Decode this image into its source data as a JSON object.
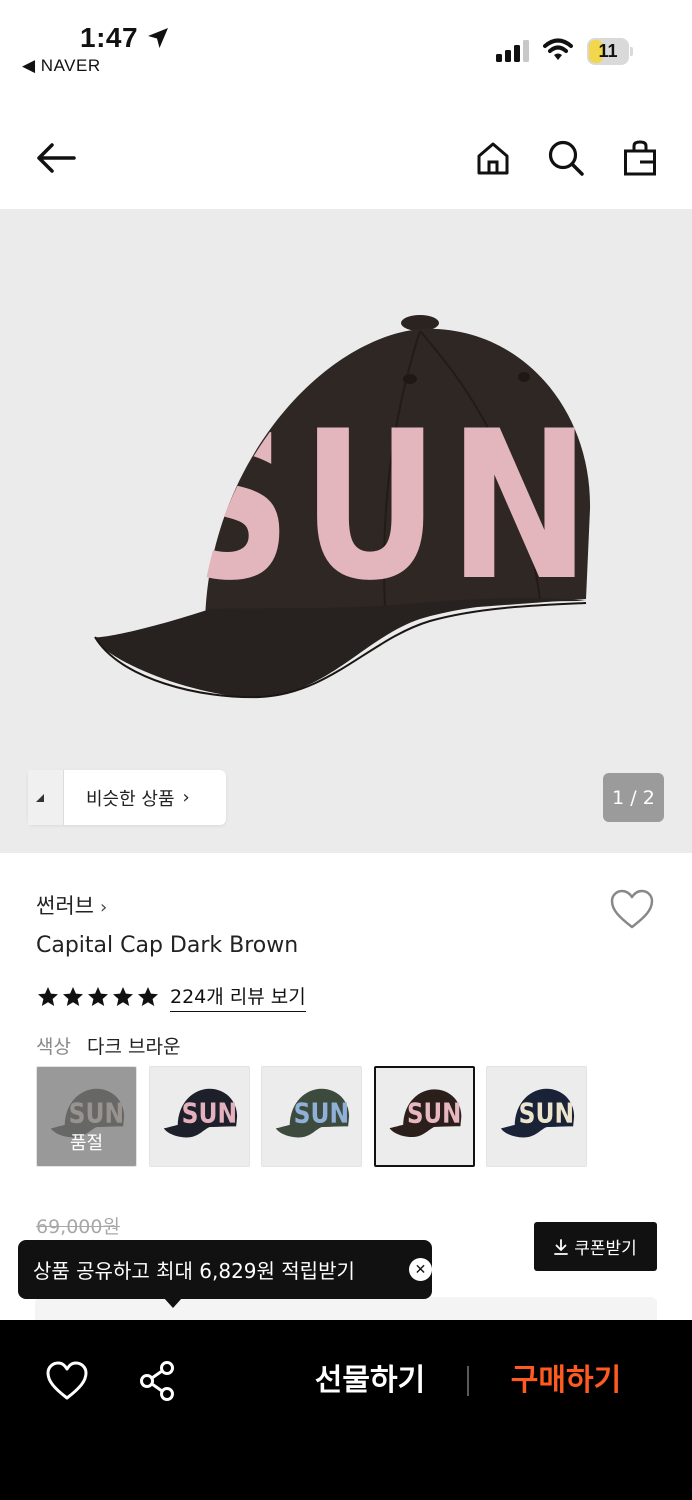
{
  "status_bar": {
    "time": "1:47",
    "back_app": "◀ NAVER",
    "battery": "11"
  },
  "icons": {
    "back": "arrow-left-icon",
    "home": "home-icon",
    "search": "search-icon",
    "bag": "shopping-bag-icon",
    "wish": "heart-icon",
    "share": "share-icon",
    "download": "download-icon",
    "close": "close-circle-icon"
  },
  "gallery": {
    "similar_label": "비슷한 상품",
    "counter": "1 / 2",
    "cap_text": "SUN"
  },
  "product": {
    "brand": "썬러브",
    "brand_chevron": "›",
    "title": "Capital Cap Dark Brown",
    "rating": 5,
    "review_link": "224개 리뷰 보기",
    "color_label": "색상",
    "color_value": "다크 브라운",
    "swatches": [
      {
        "color": "#3a3a32",
        "text_color": "#e8d8c8",
        "soldout": true,
        "soldout_label": "품절"
      },
      {
        "color": "#1d1f2a",
        "text_color": "#e4b0bc",
        "soldout": false
      },
      {
        "color": "#3d4a3e",
        "text_color": "#8fb0d8",
        "soldout": false
      },
      {
        "color": "#2b1f1c",
        "text_color": "#e8b8c0",
        "soldout": false,
        "selected": true
      },
      {
        "color": "#1a2238",
        "text_color": "#ece4cc",
        "soldout": false
      }
    ],
    "original_price": "69,000원",
    "coupon_label": "쿠폰받기"
  },
  "tooltip": {
    "text": "상품 공유하고 최대 6,829원 적립받기"
  },
  "bottom_bar": {
    "gift_label": "선물하기",
    "buy_label": "구매하기"
  },
  "colors": {
    "accent_buy": "#ff5a1f",
    "cap_body": "#2e2723",
    "cap_letters": "#e2b6bc",
    "image_bg": "#ebebeb"
  }
}
